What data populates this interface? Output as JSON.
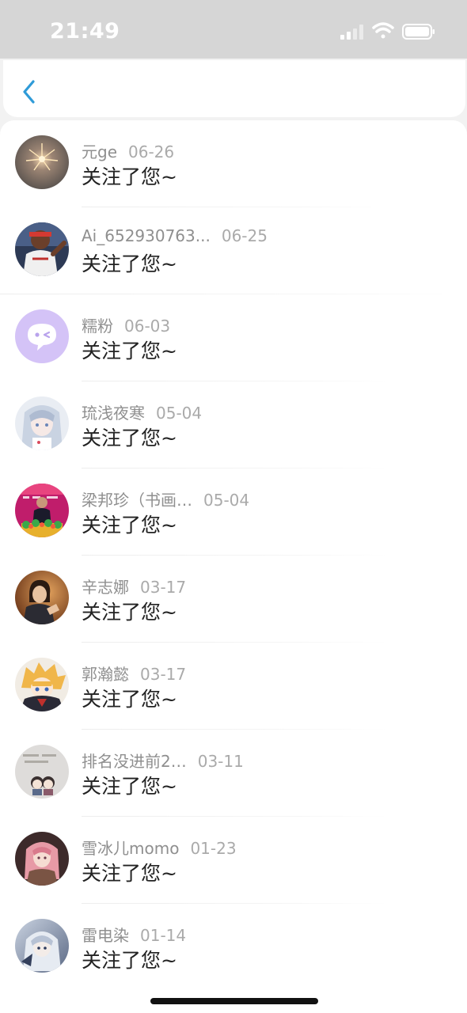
{
  "status_bar": {
    "time": "21:49"
  },
  "colors": {
    "accent": "#2f9bd8",
    "status_bar_bg": "#d6d6d6"
  },
  "nav": {
    "back_icon": "chevron-left-icon"
  },
  "notifications": [
    {
      "name": "元ge",
      "date": "06-26",
      "message": "关注了您~"
    },
    {
      "name": "Ai_652930763...",
      "date": "06-25",
      "message": "关注了您~"
    },
    {
      "name": "糯粉",
      "date": "06-03",
      "message": "关注了您~"
    },
    {
      "name": "琉浅夜寒",
      "date": "05-04",
      "message": "关注了您~"
    },
    {
      "name": "梁邦珍（书画…",
      "date": "05-04",
      "message": "关注了您~"
    },
    {
      "name": "辛志娜",
      "date": "03-17",
      "message": "关注了您~"
    },
    {
      "name": "郭瀚懿",
      "date": "03-17",
      "message": "关注了您~"
    },
    {
      "name": "排名没进前2…",
      "date": "03-11",
      "message": "关注了您~"
    },
    {
      "name": "雪冰儿momo",
      "date": "01-23",
      "message": "关注了您~"
    },
    {
      "name": "雷电染",
      "date": "01-14",
      "message": "关注了您~"
    }
  ]
}
